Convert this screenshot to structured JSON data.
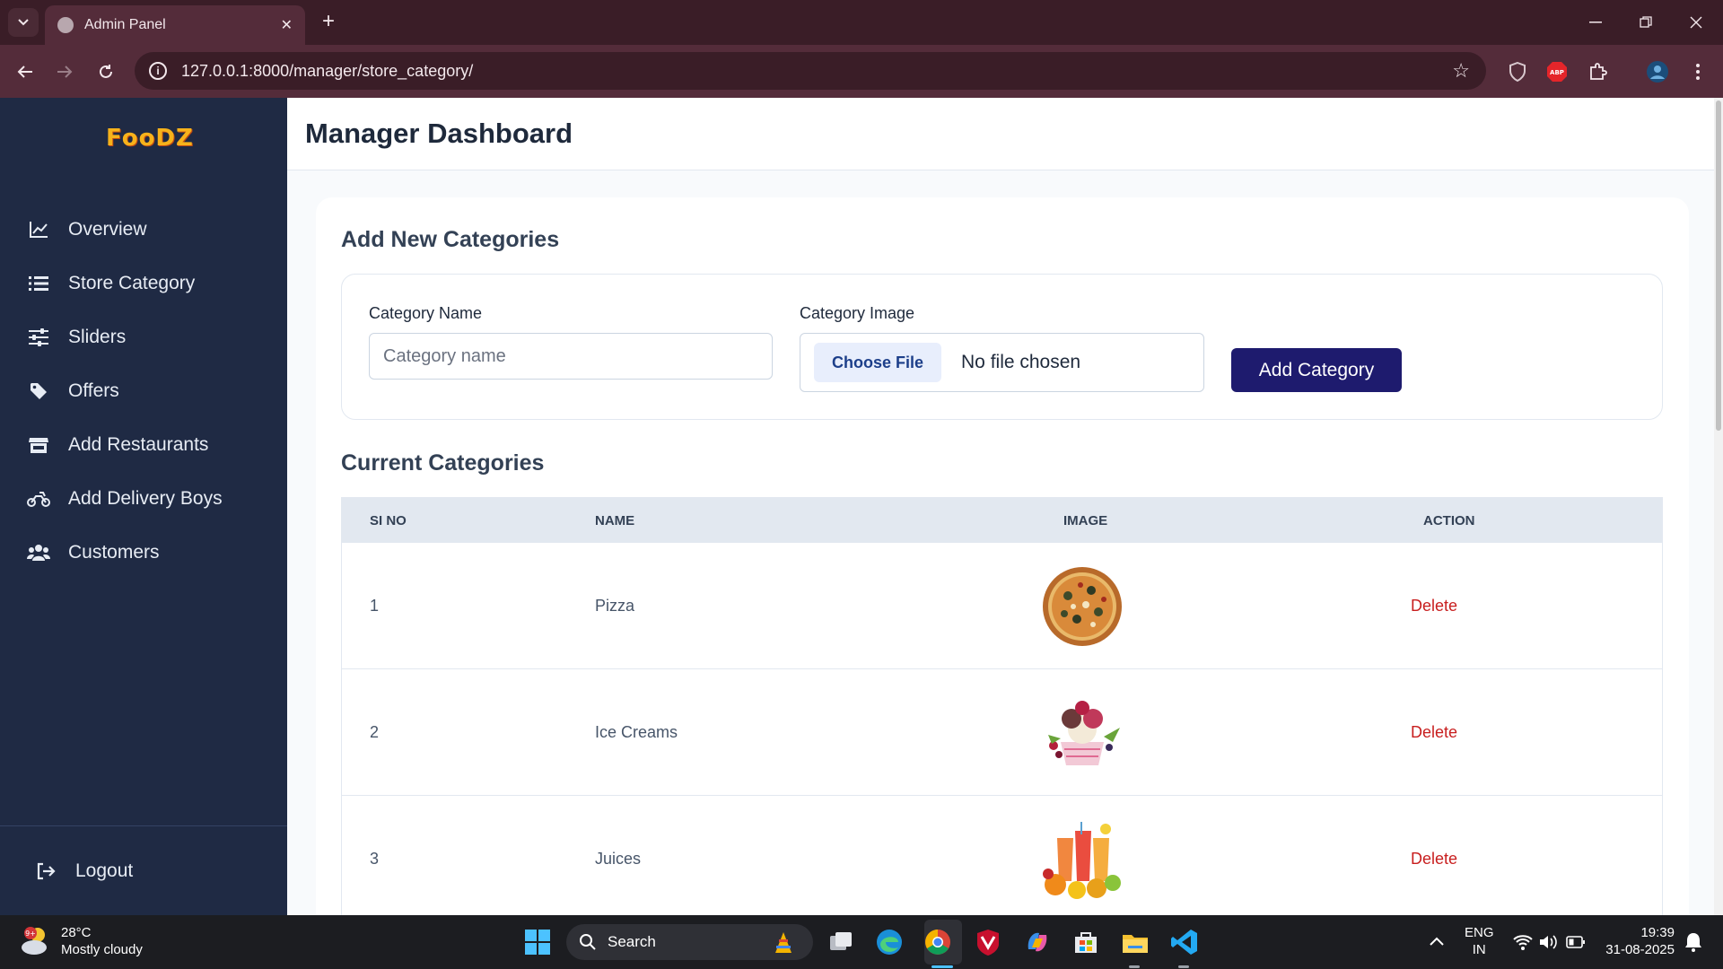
{
  "browser": {
    "tab_title": "Admin Panel",
    "url": "127.0.0.1:8000/manager/store_category/"
  },
  "sidebar": {
    "logo_text": "FooDZ",
    "items": [
      {
        "label": "Overview",
        "icon": "chart-line-icon"
      },
      {
        "label": "Store Category",
        "icon": "list-icon"
      },
      {
        "label": "Sliders",
        "icon": "sliders-icon"
      },
      {
        "label": "Offers",
        "icon": "tag-icon"
      },
      {
        "label": "Add Restaurants",
        "icon": "store-icon"
      },
      {
        "label": "Add Delivery Boys",
        "icon": "motorcycle-icon"
      },
      {
        "label": "Customers",
        "icon": "users-icon"
      }
    ],
    "logout_label": "Logout"
  },
  "header": {
    "title": "Manager Dashboard"
  },
  "form": {
    "section_title": "Add New Categories",
    "name_label": "Category Name",
    "name_placeholder": "Category name",
    "image_label": "Category Image",
    "choose_file_label": "Choose File",
    "file_status": "No file chosen",
    "submit_label": "Add Category"
  },
  "table": {
    "section_title": "Current Categories",
    "columns": [
      "SI NO",
      "NAME",
      "IMAGE",
      "ACTION"
    ],
    "rows": [
      {
        "si": "1",
        "name": "Pizza",
        "image": "pizza",
        "action": "Delete"
      },
      {
        "si": "2",
        "name": "Ice Creams",
        "image": "ice-cream",
        "action": "Delete"
      },
      {
        "si": "3",
        "name": "Juices",
        "image": "juice",
        "action": "Delete"
      }
    ]
  },
  "taskbar": {
    "weather_badge": "9+",
    "temperature": "28°C",
    "weather_desc": "Mostly cloudy",
    "search_label": "Search",
    "lang_line1": "ENG",
    "lang_line2": "IN",
    "time": "19:39",
    "date": "31-08-2025"
  },
  "colors": {
    "sidebar_bg": "#1f2a44",
    "primary_button": "#1e1b6e",
    "delete_text": "#c81e1e",
    "logo": "#f6b21b"
  }
}
